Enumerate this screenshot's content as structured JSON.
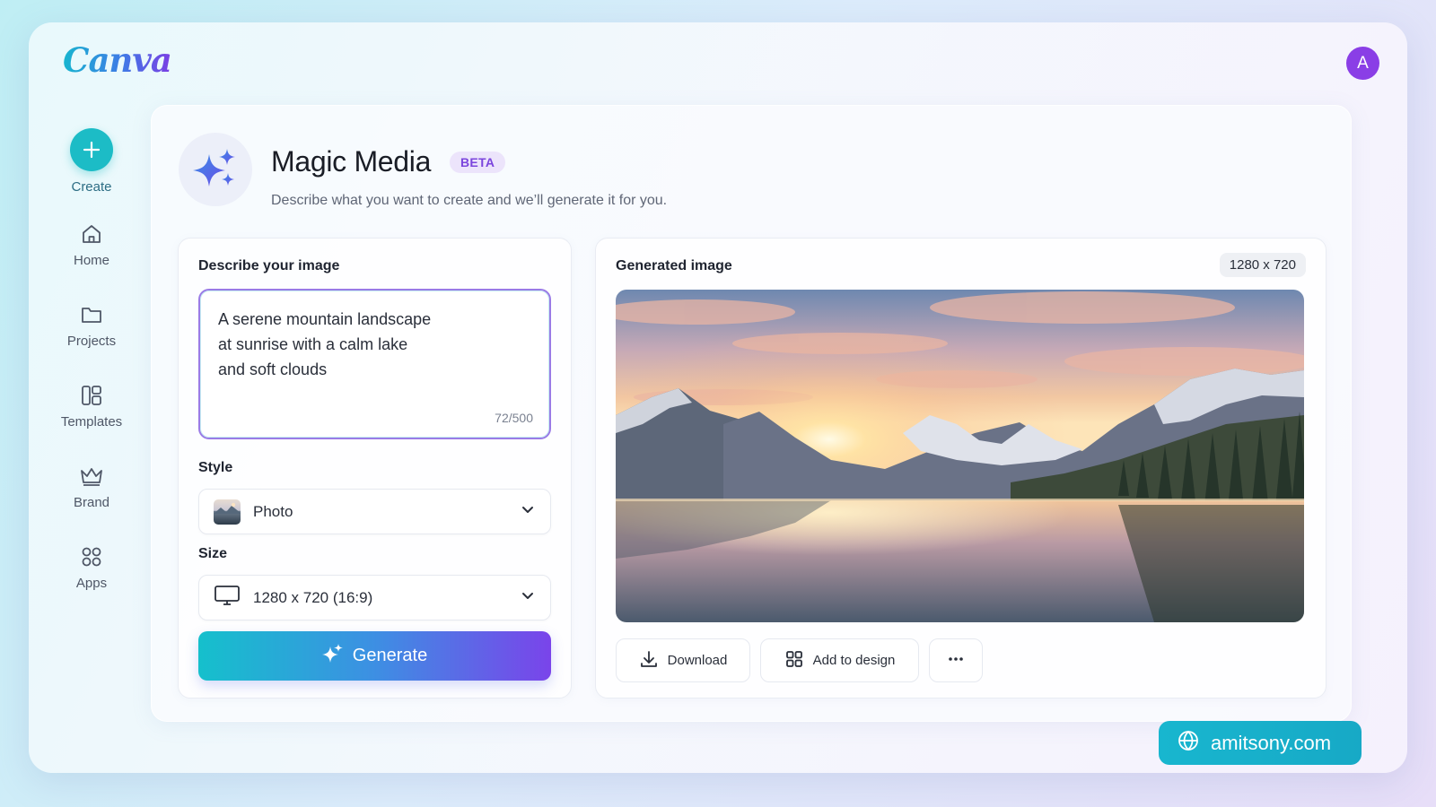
{
  "app": {
    "logo_text": "Canva",
    "avatar_initial": "A",
    "brand_color": "#8a3ee6"
  },
  "sidebar": {
    "items": [
      {
        "label": "Create",
        "icon": "plus-icon"
      },
      {
        "label": "Home",
        "icon": "home-icon"
      },
      {
        "label": "Projects",
        "icon": "folder-icon"
      },
      {
        "label": "Templates",
        "icon": "templates-icon"
      },
      {
        "label": "Brand",
        "icon": "crown-icon"
      },
      {
        "label": "Apps",
        "icon": "apps-grid-icon"
      }
    ]
  },
  "header": {
    "title": "Magic Media",
    "badge": "BETA",
    "subtitle": "Describe what you want to create and we’ll generate it for you."
  },
  "form": {
    "prompt_label": "Describe your image",
    "prompt_value": "A serene mountain landscape\nat sunrise with a calm lake\nand soft clouds",
    "char_count": "72/500",
    "style_label": "Style",
    "style_value": "Photo",
    "size_label": "Size",
    "size_value": "1280 x 720 (16:9)",
    "generate_label": "Generate"
  },
  "result": {
    "title": "Generated image",
    "dimensions": "1280 x 720",
    "actions": {
      "download": "Download",
      "add_to_design": "Add to design",
      "more": "more-options-icon"
    }
  },
  "watermark": {
    "text": "amitsony.com",
    "icon": "globe-icon"
  },
  "colors": {
    "accent_teal": "#1cbcc6",
    "accent_purple": "#7a44ea",
    "beta_text": "#7b45dd"
  }
}
